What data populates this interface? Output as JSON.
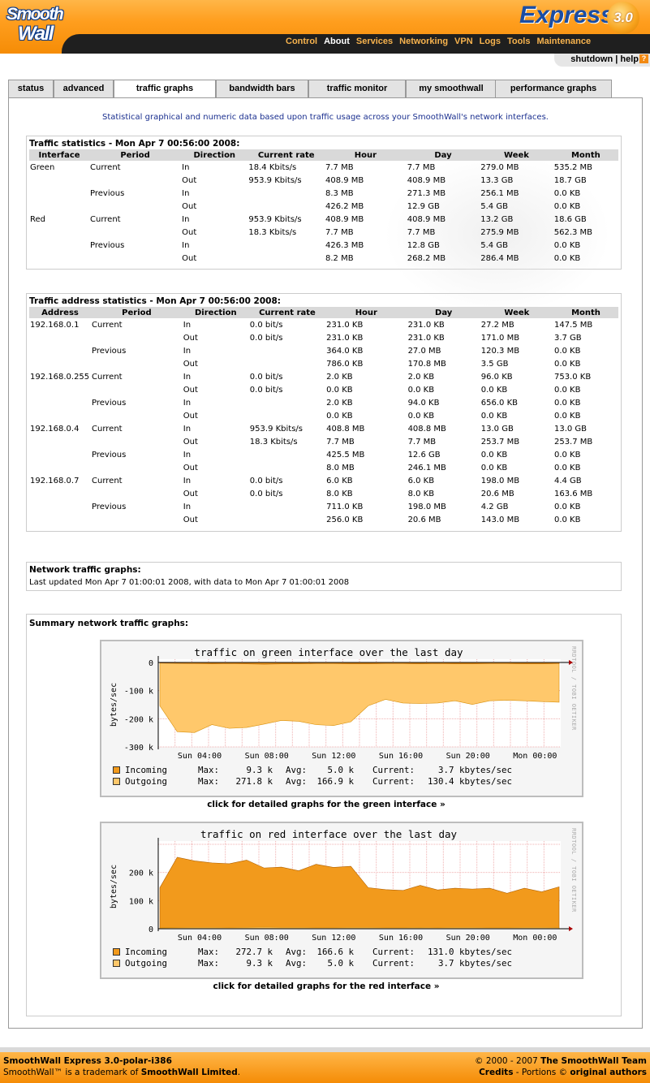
{
  "header": {
    "logo_top": "Smooth",
    "logo_bottom": "Wall",
    "product": "Express",
    "version": "3.0",
    "nav": [
      {
        "label": "Control",
        "active": false
      },
      {
        "label": "About",
        "active": true
      },
      {
        "label": "Services",
        "active": false
      },
      {
        "label": "Networking",
        "active": false
      },
      {
        "label": "VPN",
        "active": false
      },
      {
        "label": "Logs",
        "active": false
      },
      {
        "label": "Tools",
        "active": false
      },
      {
        "label": "Maintenance",
        "active": false
      }
    ],
    "shutdown": "shutdown",
    "sep": " | ",
    "help": "help",
    "help_icon": "?"
  },
  "tabs": [
    {
      "label": "status"
    },
    {
      "label": "advanced"
    },
    {
      "label": "traffic graphs",
      "active": true
    },
    {
      "label": "bandwidth bars"
    },
    {
      "label": "traffic monitor"
    },
    {
      "label": "my smoothwall"
    },
    {
      "label": "performance graphs"
    }
  ],
  "intro": "Statistical graphical and numeric data based upon traffic usage across your SmoothWall's network interfaces.",
  "traffic_stats": {
    "title": "Traffic statistics - Mon Apr 7 00:56:00 2008:",
    "headers": [
      "Interface",
      "Period",
      "Direction",
      "Current rate",
      "Hour",
      "Day",
      "Week",
      "Month"
    ],
    "rows": [
      [
        "Green",
        "Current",
        "In",
        "18.4 Kbits/s",
        "7.7 MB",
        "7.7 MB",
        "279.0 MB",
        "535.2 MB"
      ],
      [
        "",
        "",
        "Out",
        "953.9 Kbits/s",
        "408.9 MB",
        "408.9 MB",
        "13.3 GB",
        "18.7 GB"
      ],
      [
        "",
        "Previous",
        "In",
        "",
        "8.3 MB",
        "271.3 MB",
        "256.1 MB",
        "0.0 KB"
      ],
      [
        "",
        "",
        "Out",
        "",
        "426.2 MB",
        "12.9 GB",
        "5.4 GB",
        "0.0 KB"
      ],
      [
        "Red",
        "Current",
        "In",
        "953.9 Kbits/s",
        "408.9 MB",
        "408.9 MB",
        "13.2 GB",
        "18.6 GB"
      ],
      [
        "",
        "",
        "Out",
        "18.3 Kbits/s",
        "7.7 MB",
        "7.7 MB",
        "275.9 MB",
        "562.3 MB"
      ],
      [
        "",
        "Previous",
        "In",
        "",
        "426.3 MB",
        "12.8 GB",
        "5.4 GB",
        "0.0 KB"
      ],
      [
        "",
        "",
        "Out",
        "",
        "8.2 MB",
        "268.2 MB",
        "286.4 MB",
        "0.0 KB"
      ]
    ]
  },
  "address_stats": {
    "title": "Traffic address statistics - Mon Apr 7 00:56:00 2008:",
    "headers": [
      "Address",
      "Period",
      "Direction",
      "Current rate",
      "Hour",
      "Day",
      "Week",
      "Month"
    ],
    "rows": [
      [
        "192.168.0.1",
        "Current",
        "In",
        "0.0 bit/s",
        "231.0 KB",
        "231.0 KB",
        "27.2 MB",
        "147.5 MB"
      ],
      [
        "",
        "",
        "Out",
        "0.0 bit/s",
        "231.0 KB",
        "231.0 KB",
        "171.0 MB",
        "3.7 GB"
      ],
      [
        "",
        "Previous",
        "In",
        "",
        "364.0 KB",
        "27.0 MB",
        "120.3 MB",
        "0.0 KB"
      ],
      [
        "",
        "",
        "Out",
        "",
        "786.0 KB",
        "170.8 MB",
        "3.5 GB",
        "0.0 KB"
      ],
      [
        "192.168.0.255",
        "Current",
        "In",
        "0.0 bit/s",
        "2.0 KB",
        "2.0 KB",
        "96.0 KB",
        "753.0 KB"
      ],
      [
        "",
        "",
        "Out",
        "0.0 bit/s",
        "0.0 KB",
        "0.0 KB",
        "0.0 KB",
        "0.0 KB"
      ],
      [
        "",
        "Previous",
        "In",
        "",
        "2.0 KB",
        "94.0 KB",
        "656.0 KB",
        "0.0 KB"
      ],
      [
        "",
        "",
        "Out",
        "",
        "0.0 KB",
        "0.0 KB",
        "0.0 KB",
        "0.0 KB"
      ],
      [
        "192.168.0.4",
        "Current",
        "In",
        "953.9 Kbits/s",
        "408.8 MB",
        "408.8 MB",
        "13.0 GB",
        "13.0 GB"
      ],
      [
        "",
        "",
        "Out",
        "18.3 Kbits/s",
        "7.7 MB",
        "7.7 MB",
        "253.7 MB",
        "253.7 MB"
      ],
      [
        "",
        "Previous",
        "In",
        "",
        "425.5 MB",
        "12.6 GB",
        "0.0 KB",
        "0.0 KB"
      ],
      [
        "",
        "",
        "Out",
        "",
        "8.0 MB",
        "246.1 MB",
        "0.0 KB",
        "0.0 KB"
      ],
      [
        "192.168.0.7",
        "Current",
        "In",
        "0.0 bit/s",
        "6.0 KB",
        "6.0 KB",
        "198.0 MB",
        "4.4 GB"
      ],
      [
        "",
        "",
        "Out",
        "0.0 bit/s",
        "8.0 KB",
        "8.0 KB",
        "20.6 MB",
        "163.6 MB"
      ],
      [
        "",
        "Previous",
        "In",
        "",
        "711.0 KB",
        "198.0 MB",
        "4.2 GB",
        "0.0 KB"
      ],
      [
        "",
        "",
        "Out",
        "",
        "256.0 KB",
        "20.6 MB",
        "143.0 MB",
        "0.0 KB"
      ]
    ]
  },
  "network_graphs": {
    "title": "Network traffic graphs:",
    "updated": "Last updated Mon Apr 7 01:00:01 2008, with data to Mon Apr 7 01:00:01 2008"
  },
  "summary_title": "Summary network traffic graphs:",
  "side_label": "RRDTOOL / TOBI OETIKER",
  "chart_data": [
    {
      "type": "area",
      "title": "traffic on green interface over the last day",
      "ylabel": "bytes/sec",
      "ylim": [
        -300,
        0
      ],
      "yticks": [
        "0",
        "-100 k",
        "-200 k",
        "-300 k"
      ],
      "xticks": [
        "Sun 04:00",
        "Sun 08:00",
        "Sun 12:00",
        "Sun 16:00",
        "Sun 20:00",
        "Mon 00:00"
      ],
      "series": [
        {
          "name": "Incoming",
          "color": "#f29a1c",
          "values": [
            -2,
            -3,
            -4,
            -5,
            -4,
            -5,
            -6,
            -5,
            -5,
            -4,
            -4,
            -5,
            -5,
            -4,
            -4,
            -5,
            -4,
            -5,
            -5,
            -4,
            -4,
            -5,
            -5,
            -4
          ]
        },
        {
          "name": "Outgoing",
          "color": "#ffc86b",
          "values": [
            -150,
            -250,
            -245,
            -225,
            -230,
            -235,
            -215,
            -210,
            -205,
            -225,
            -220,
            -215,
            -150,
            -135,
            -140,
            -150,
            -140,
            -140,
            -145,
            -140,
            -130,
            -140,
            -135,
            -145
          ]
        }
      ],
      "legend": [
        {
          "name": "Incoming",
          "max": "9.3 k",
          "avg": "5.0 k",
          "current": "3.7 kbytes/sec",
          "color": "#f29a1c"
        },
        {
          "name": "Outgoing",
          "max": "271.8 k",
          "avg": "166.9 k",
          "current": "130.4 kbytes/sec",
          "color": "#ffc86b"
        }
      ],
      "link": "click for detailed graphs for the green interface »"
    },
    {
      "type": "area",
      "title": "traffic on red interface over the last day",
      "ylabel": "bytes/sec",
      "ylim": [
        0,
        300
      ],
      "yticks": [
        "200 k",
        "100 k",
        "0"
      ],
      "xticks": [
        "Sun 04:00",
        "Sun 08:00",
        "Sun 12:00",
        "Sun 16:00",
        "Sun 20:00",
        "Mon 00:00"
      ],
      "series": [
        {
          "name": "Incoming",
          "color": "#f29a1c",
          "values": [
            150,
            250,
            245,
            230,
            235,
            240,
            220,
            215,
            210,
            225,
            222,
            218,
            150,
            135,
            140,
            150,
            142,
            140,
            145,
            140,
            130,
            140,
            135,
            145
          ]
        },
        {
          "name": "Outgoing",
          "color": "#ffc86b",
          "values": [
            3,
            4,
            5,
            5,
            4,
            5,
            6,
            5,
            5,
            4,
            4,
            5,
            5,
            4,
            4,
            5,
            4,
            5,
            5,
            4,
            4,
            5,
            5,
            4
          ]
        }
      ],
      "legend": [
        {
          "name": "Incoming",
          "max": "272.7 k",
          "avg": "166.6 k",
          "current": "131.0 kbytes/sec",
          "color": "#f29a1c"
        },
        {
          "name": "Outgoing",
          "max": "9.3 k",
          "avg": "5.0 k",
          "current": "3.7 kbytes/sec",
          "color": "#ffc86b"
        }
      ],
      "link": "click for detailed graphs for the red interface »"
    }
  ],
  "legend_labels": {
    "max": "Max:",
    "avg": "Avg:",
    "current": "Current:"
  },
  "footer": {
    "product": "SmoothWall Express 3.0-polar-i386",
    "trademark_pre": "SmoothWall™ is a trademark of ",
    "trademark_co": "SmoothWall Limited",
    "trademark_end": ".",
    "copyright_pre": "© 2000 - 2007 ",
    "copyright_team": "The SmoothWall Team",
    "credits": "Credits",
    "portions": " - Portions © ",
    "authors": "original authors"
  }
}
